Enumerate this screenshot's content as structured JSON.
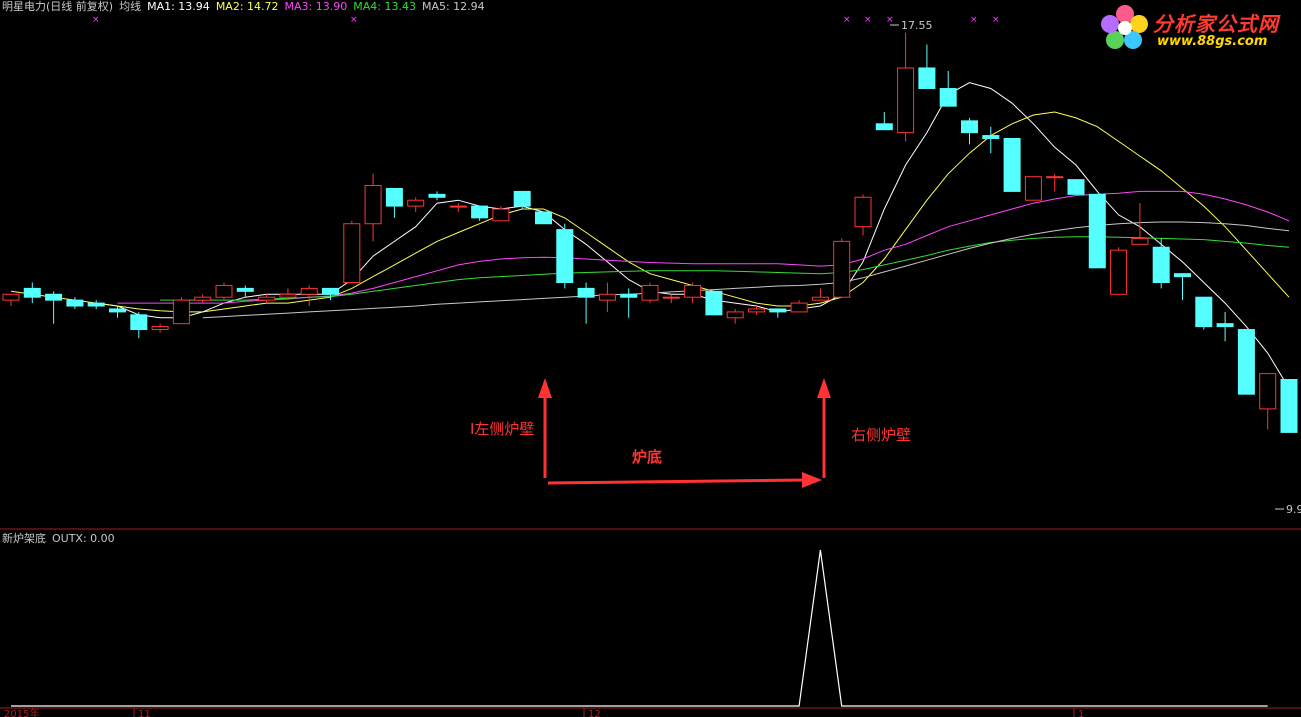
{
  "header": {
    "title": "明星电力(日线 前复权)",
    "indicator": "均线",
    "ma_values": [
      {
        "label": "MA1: 13.94",
        "color": "#ffffff"
      },
      {
        "label": "MA2: 14.72",
        "color": "#ffff55"
      },
      {
        "label": "MA3: 13.90",
        "color": "#ff44ff"
      },
      {
        "label": "MA4: 13.43",
        "color": "#33dd33"
      },
      {
        "label": "MA5: 12.94",
        "color": "#c8c8c8"
      }
    ]
  },
  "sub_header": {
    "name": "新炉架底",
    "value": "OUTX: 0.00"
  },
  "logo": {
    "title": "分析家公式网",
    "url": "www.88gs.com"
  },
  "annotations": {
    "left_wall": "I左侧炉壁",
    "bottom": "炉底",
    "right_wall": "右侧炉壁",
    "high_label": "17.55",
    "low_label": "9.9"
  },
  "x_axis": {
    "labels": [
      "2015年",
      "11",
      "12",
      "1"
    ]
  },
  "colors": {
    "up": "#ff3333",
    "down": "#55ffff",
    "background": "#000000",
    "divider": "#a02020",
    "arrow": "#ff3333",
    "annotation_text": "#ff3333"
  },
  "chart_data": [
    {
      "type": "candlestick",
      "title": "明星电力(日线 前复权)",
      "ylim": [
        9.6,
        17.8
      ],
      "candles": [
        [
          13.0,
          13.1,
          12.9,
          13.1
        ],
        [
          13.2,
          13.3,
          12.95,
          13.05
        ],
        [
          13.1,
          13.15,
          12.6,
          13.0
        ],
        [
          13.0,
          13.05,
          12.85,
          12.9
        ],
        [
          12.95,
          13.0,
          12.85,
          12.9
        ],
        [
          12.85,
          12.9,
          12.7,
          12.8
        ],
        [
          12.75,
          12.8,
          12.35,
          12.5
        ],
        [
          12.5,
          12.6,
          12.45,
          12.55
        ],
        [
          12.6,
          13.05,
          12.6,
          13.0
        ],
        [
          13.0,
          13.1,
          12.95,
          13.05
        ],
        [
          13.05,
          13.3,
          13.0,
          13.25
        ],
        [
          13.2,
          13.25,
          13.05,
          13.15
        ],
        [
          13.0,
          13.1,
          12.95,
          13.05
        ],
        [
          13.05,
          13.2,
          13.0,
          13.1
        ],
        [
          13.1,
          13.25,
          12.9,
          13.2
        ],
        [
          13.2,
          13.2,
          13.0,
          13.1
        ],
        [
          13.3,
          14.35,
          13.3,
          14.3
        ],
        [
          14.3,
          15.15,
          14.0,
          14.95
        ],
        [
          14.9,
          14.9,
          14.4,
          14.6
        ],
        [
          14.6,
          14.75,
          14.5,
          14.7
        ],
        [
          14.8,
          14.85,
          14.7,
          14.75
        ],
        [
          14.6,
          14.65,
          14.5,
          14.6
        ],
        [
          14.6,
          14.6,
          14.35,
          14.4
        ],
        [
          14.35,
          14.6,
          14.35,
          14.55
        ],
        [
          14.85,
          14.85,
          14.55,
          14.6
        ],
        [
          14.5,
          14.5,
          14.3,
          14.3
        ],
        [
          14.2,
          14.3,
          13.2,
          13.3
        ],
        [
          13.2,
          13.3,
          12.6,
          13.05
        ],
        [
          13.0,
          13.3,
          12.8,
          13.1
        ],
        [
          13.1,
          13.2,
          12.7,
          13.05
        ],
        [
          13.0,
          13.3,
          12.95,
          13.25
        ],
        [
          13.05,
          13.1,
          12.95,
          13.05
        ],
        [
          13.05,
          13.3,
          12.95,
          13.25
        ],
        [
          13.15,
          13.15,
          12.75,
          12.75
        ],
        [
          12.7,
          12.85,
          12.6,
          12.8
        ],
        [
          12.8,
          12.9,
          12.75,
          12.85
        ],
        [
          12.85,
          12.85,
          12.7,
          12.8
        ],
        [
          12.8,
          13.0,
          12.8,
          12.95
        ],
        [
          13.0,
          13.2,
          13.0,
          13.05
        ],
        [
          13.05,
          14.05,
          13.05,
          14.0
        ],
        [
          14.25,
          14.8,
          14.1,
          14.75
        ],
        [
          16.0,
          16.2,
          15.9,
          15.9
        ],
        [
          15.85,
          17.55,
          15.7,
          16.95
        ],
        [
          16.95,
          17.35,
          16.6,
          16.6
        ],
        [
          16.6,
          16.9,
          16.3,
          16.3
        ],
        [
          16.05,
          16.1,
          15.65,
          15.85
        ],
        [
          15.8,
          15.95,
          15.5,
          15.75
        ],
        [
          15.75,
          15.75,
          14.85,
          14.85
        ],
        [
          14.7,
          15.1,
          14.7,
          15.1
        ],
        [
          15.1,
          15.15,
          14.85,
          15.1
        ],
        [
          15.05,
          15.05,
          14.8,
          14.8
        ],
        [
          14.8,
          14.8,
          13.55,
          13.55
        ],
        [
          13.1,
          13.9,
          13.1,
          13.85
        ],
        [
          13.95,
          14.65,
          13.95,
          14.05
        ],
        [
          13.9,
          14.05,
          13.2,
          13.3
        ],
        [
          13.45,
          13.45,
          13.0,
          13.4
        ],
        [
          13.05,
          13.05,
          12.5,
          12.55
        ],
        [
          12.6,
          12.8,
          12.3,
          12.55
        ],
        [
          12.5,
          12.5,
          11.4,
          11.4
        ],
        [
          11.15,
          11.75,
          10.8,
          11.75
        ],
        [
          11.65,
          11.65,
          10.75,
          10.75
        ]
      ],
      "ma_series": [
        {
          "name": "MA1",
          "color": "#ffffff",
          "values": [
            null,
            null,
            null,
            null,
            12.95,
            12.9,
            12.75,
            12.7,
            12.7,
            12.8,
            12.95,
            13.05,
            13.1,
            13.1,
            13.1,
            13.1,
            13.35,
            13.75,
            14.0,
            14.25,
            14.65,
            14.7,
            14.6,
            14.55,
            14.6,
            14.5,
            14.2,
            13.95,
            13.65,
            13.35,
            13.15,
            13.1,
            13.1,
            13.0,
            12.95,
            12.9,
            12.8,
            12.85,
            12.9,
            13.1,
            13.65,
            14.55,
            15.3,
            15.85,
            16.5,
            16.7,
            16.6,
            16.35,
            16.0,
            15.6,
            15.3,
            14.85,
            14.45,
            14.25,
            13.95,
            13.65,
            13.3,
            12.95,
            12.55,
            12.1,
            11.5
          ]
        },
        {
          "name": "MA2",
          "color": "#ffff55",
          "values": [
            13.15,
            13.1,
            13.05,
            13.0,
            12.95,
            12.9,
            12.85,
            12.82,
            12.8,
            12.8,
            12.85,
            12.9,
            12.95,
            12.95,
            13.0,
            13.05,
            13.2,
            13.4,
            13.6,
            13.8,
            14.0,
            14.15,
            14.3,
            14.45,
            14.55,
            14.55,
            14.4,
            14.15,
            13.9,
            13.65,
            13.45,
            13.35,
            13.25,
            13.15,
            13.05,
            12.95,
            12.9,
            12.9,
            12.95,
            13.05,
            13.3,
            13.7,
            14.2,
            14.7,
            15.15,
            15.5,
            15.8,
            16.0,
            16.15,
            16.2,
            16.1,
            15.95,
            15.7,
            15.45,
            15.2,
            14.9,
            14.6,
            14.25,
            13.85,
            13.45,
            13.05
          ]
        },
        {
          "name": "MA3",
          "color": "#ff44ff",
          "values": [
            null,
            null,
            null,
            null,
            null,
            12.95,
            12.95,
            12.95,
            12.95,
            12.95,
            12.95,
            12.98,
            13.0,
            13.02,
            13.05,
            13.07,
            13.12,
            13.2,
            13.3,
            13.4,
            13.5,
            13.6,
            13.66,
            13.7,
            13.72,
            13.73,
            13.72,
            13.7,
            13.68,
            13.66,
            13.64,
            13.63,
            13.62,
            13.62,
            13.62,
            13.62,
            13.62,
            13.6,
            13.58,
            13.6,
            13.7,
            13.85,
            13.95,
            14.1,
            14.25,
            14.35,
            14.45,
            14.55,
            14.65,
            14.72,
            14.78,
            14.8,
            14.82,
            14.85,
            14.85,
            14.85,
            14.8,
            14.72,
            14.62,
            14.5,
            14.35
          ]
        },
        {
          "name": "MA4",
          "color": "#33dd33",
          "values": [
            null,
            null,
            null,
            null,
            null,
            null,
            null,
            13.0,
            13.0,
            13.0,
            13.0,
            13.0,
            13.02,
            13.03,
            13.05,
            13.06,
            13.1,
            13.15,
            13.2,
            13.25,
            13.3,
            13.35,
            13.38,
            13.4,
            13.42,
            13.44,
            13.46,
            13.47,
            13.48,
            13.49,
            13.5,
            13.5,
            13.5,
            13.5,
            13.49,
            13.48,
            13.47,
            13.46,
            13.45,
            13.47,
            13.52,
            13.6,
            13.68,
            13.76,
            13.85,
            13.92,
            13.98,
            14.02,
            14.05,
            14.07,
            14.08,
            14.08,
            14.07,
            14.06,
            14.05,
            14.04,
            14.03,
            14.0,
            13.97,
            13.93,
            13.9
          ]
        },
        {
          "name": "MA5",
          "color": "#c8c8c8",
          "values": [
            null,
            null,
            null,
            null,
            null,
            null,
            null,
            null,
            null,
            12.7,
            12.72,
            12.74,
            12.76,
            12.78,
            12.8,
            12.82,
            12.84,
            12.86,
            12.88,
            12.9,
            12.93,
            12.95,
            12.97,
            12.99,
            13.01,
            13.03,
            13.05,
            13.07,
            13.09,
            13.1,
            13.12,
            13.14,
            13.16,
            13.18,
            13.2,
            13.22,
            13.24,
            13.25,
            13.27,
            13.3,
            13.38,
            13.48,
            13.58,
            13.68,
            13.78,
            13.88,
            13.97,
            14.05,
            14.12,
            14.18,
            14.23,
            14.27,
            14.3,
            14.32,
            14.33,
            14.33,
            14.32,
            14.3,
            14.27,
            14.22,
            14.18
          ]
        }
      ]
    },
    {
      "type": "line",
      "title": "新炉架底",
      "series": [
        {
          "name": "OUTX",
          "values": [
            0,
            0,
            0,
            0,
            0,
            0,
            0,
            0,
            0,
            0,
            0,
            0,
            0,
            0,
            0,
            0,
            0,
            0,
            0,
            0,
            0,
            0,
            0,
            0,
            0,
            0,
            0,
            0,
            0,
            0,
            0,
            0,
            0,
            0,
            0,
            0,
            0,
            0,
            1,
            0,
            0,
            0,
            0,
            0,
            0,
            0,
            0,
            0,
            0,
            0,
            0,
            0,
            0,
            0,
            0,
            0,
            0,
            0,
            0,
            0
          ]
        }
      ],
      "ylim": [
        0,
        1
      ]
    }
  ]
}
